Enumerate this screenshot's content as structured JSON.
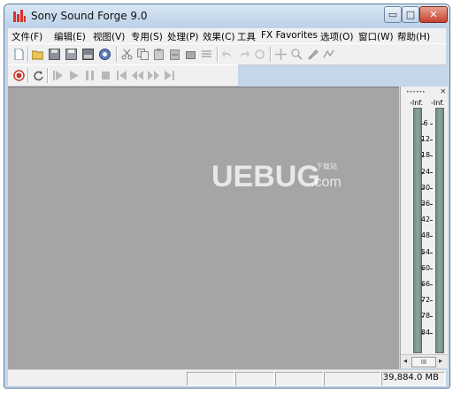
{
  "window": {
    "title": "Sony Sound Forge 9.0",
    "controls": {
      "minimize": "▭",
      "maximize": "□",
      "close": "✕"
    }
  },
  "menu": {
    "items": [
      "文件(F)",
      "编辑(E)",
      "视图(V)",
      "专用(S)",
      "处理(P)",
      "效果(C)",
      "工具",
      "FX Favorites",
      "选项(O)",
      "窗口(W)",
      "帮助(H)"
    ]
  },
  "toolbar_main": {
    "icons": [
      "new-file-icon",
      "open-folder-icon",
      "save-icon",
      "save-all-icon",
      "render-icon",
      "properties-icon",
      "cut-icon",
      "copy-icon",
      "paste-icon",
      "mix-icon",
      "crop-icon",
      "trim-icon",
      "undo-icon",
      "redo-icon",
      "repeat-icon",
      "zoom-icon",
      "magnify-icon",
      "pencil-icon",
      "envelope-icon"
    ]
  },
  "toolbar_transport": {
    "icons": [
      "record-icon",
      "loop-icon",
      "play-all-icon",
      "play-icon",
      "pause-icon",
      "stop-icon",
      "go-to-start-icon",
      "rewind-icon",
      "forward-icon",
      "go-to-end-icon"
    ]
  },
  "meters": {
    "peak_left": "-Inf.",
    "peak_right": "-Inf.",
    "scale": [
      "6",
      "12",
      "18",
      "24",
      "30",
      "36",
      "42",
      "48",
      "54",
      "60",
      "66",
      "72",
      "78",
      "84"
    ],
    "scroll_thumb": "III",
    "scroll_left": "◂",
    "scroll_right": "▸",
    "close": "×"
  },
  "status": {
    "disk_space": "39,884.0 MB"
  },
  "watermark": {
    "text": "UEBUG",
    "suffix": ".com",
    "tag": "下载站"
  },
  "colors": {
    "workspace": "#a5a5a5",
    "meter_bar": "#7f9a8f",
    "record": "#c0392b"
  }
}
